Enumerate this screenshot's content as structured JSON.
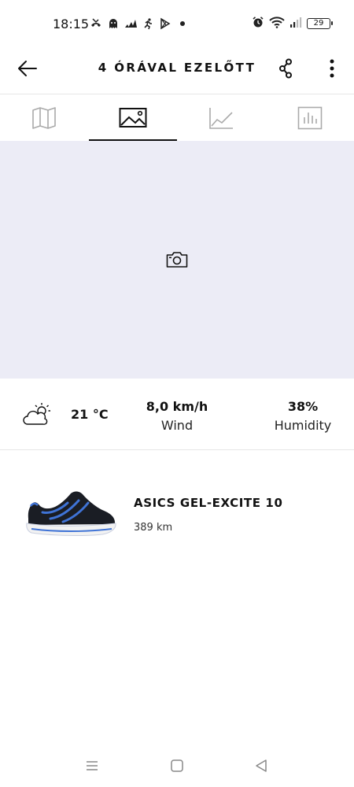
{
  "status_bar": {
    "time": "18:15",
    "battery": "29",
    "icons_left": [
      "missed-call-icon",
      "ghost-icon",
      "adidas-icon",
      "runner-icon",
      "play-store-icon",
      "dot-icon"
    ],
    "icons_right": [
      "alarm-icon",
      "wifi-icon",
      "signal-icon",
      "battery-icon"
    ]
  },
  "header": {
    "title": "4 ÓRÁVAL EZELŐTT",
    "back_icon": "arrow-left-icon",
    "share_icon": "share-icon",
    "more_icon": "more-vertical-icon"
  },
  "tabs": [
    {
      "icon": "map-icon",
      "active": false
    },
    {
      "icon": "image-icon",
      "active": true
    },
    {
      "icon": "line-chart-icon",
      "active": false
    },
    {
      "icon": "bar-chart-icon",
      "active": false
    }
  ],
  "photo_area": {
    "icon": "camera-icon",
    "background": "#ececf6"
  },
  "weather": {
    "icon": "partly-sunny-icon",
    "temperature": "21 °C",
    "wind_value": "8,0 km/h",
    "wind_label": "Wind",
    "humidity_value": "38%",
    "humidity_label": "Humidity"
  },
  "shoe": {
    "name": "ASICS GEL-EXCITE 10",
    "distance": "389 km",
    "colors": {
      "upper": "#1a1d24",
      "accent": "#3f73d6",
      "sole": "#f2f2f2"
    }
  },
  "nav_bar": {
    "icons": [
      "recents-icon",
      "home-icon",
      "back-icon"
    ]
  }
}
